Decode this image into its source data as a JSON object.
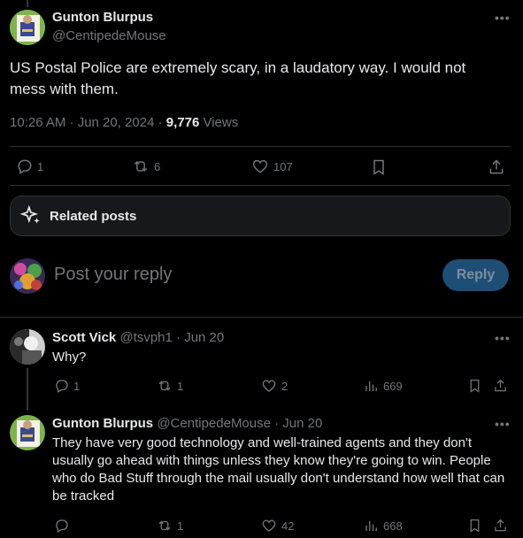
{
  "main_post": {
    "author_name": "Gunton Blurpus",
    "author_handle": "@CentipedeMouse",
    "text": "US Postal Police are extremely scary, in a laudatory way. I would not mess with them.",
    "time_date": "10:26 AM · Jun 20, 2024 · ",
    "views_count": "9,776",
    "views_label": " Views",
    "replies": "1",
    "reposts": "6",
    "likes": "107"
  },
  "related_posts_label": "Related posts",
  "composer": {
    "placeholder": "Post your reply",
    "reply_label": "Reply"
  },
  "replies": [
    {
      "author_name": "Scott Vick",
      "author_handle": "@tsvph1",
      "date": " · Jun 20",
      "text": "Why?",
      "replies": "1",
      "reposts": "1",
      "likes": "2",
      "views": "669"
    },
    {
      "author_name": "Gunton Blurpus",
      "author_handle": "@CentipedeMouse",
      "date": " · Jun 20",
      "text": "They have very good technology and well-trained agents and they don't usually go ahead with things unless they know they're going to win. People who do Bad Stuff through the mail usually don't understand how well that can be tracked",
      "replies": "",
      "reposts": "1",
      "likes": "42",
      "views": "668"
    }
  ],
  "icons": {
    "more": "more-dots-icon",
    "reply": "reply-bubble-icon",
    "repost": "repost-icon",
    "like": "heart-icon",
    "bookmark": "bookmark-icon",
    "share": "share-icon",
    "views": "views-chart-icon",
    "sparkle": "sparkle-icon"
  },
  "colors": {
    "background": "#000000",
    "text": "#e7e9ea",
    "muted": "#71767b",
    "divider": "#2f3336",
    "reply_button": "#1d4e75"
  }
}
